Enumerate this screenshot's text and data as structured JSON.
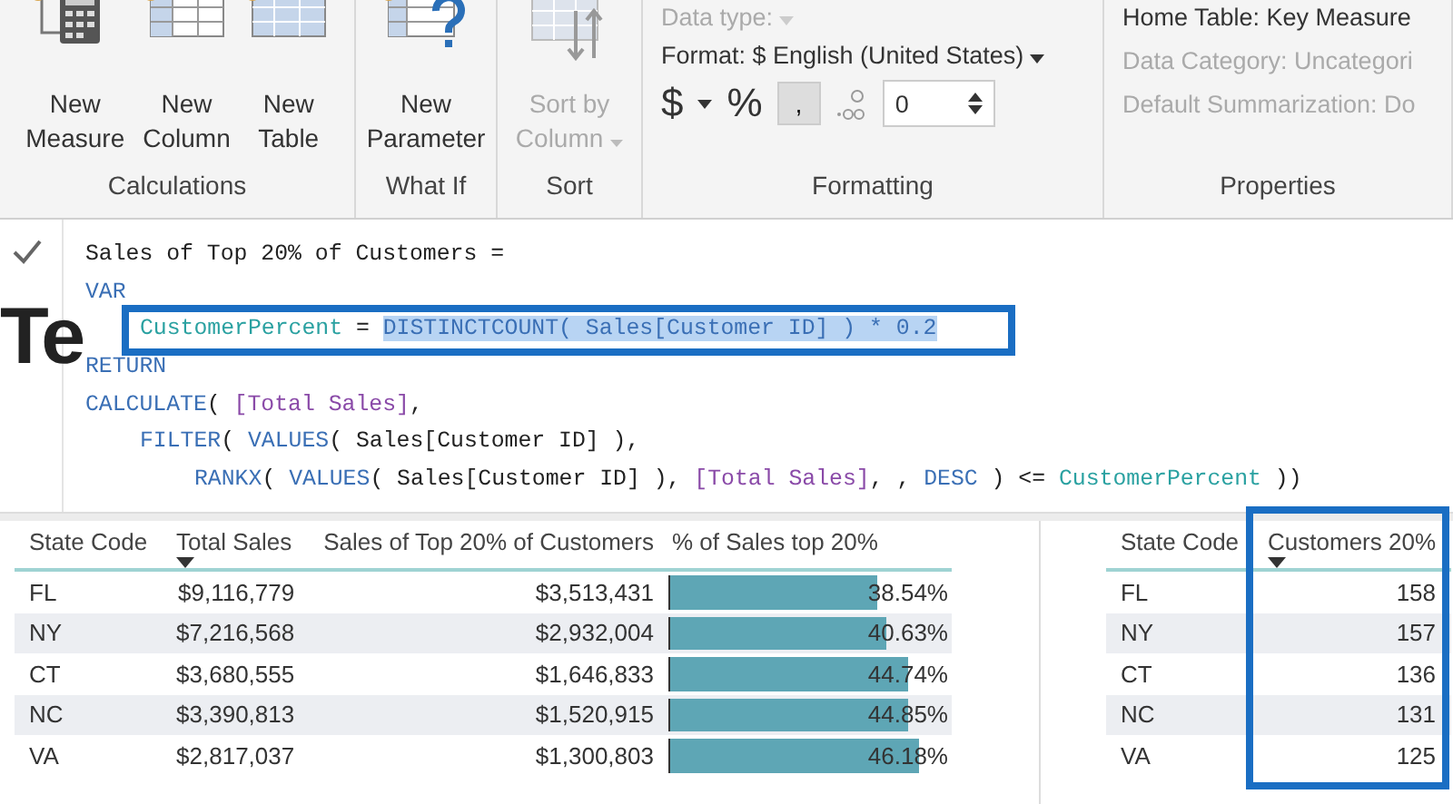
{
  "ribbon": {
    "groups": [
      {
        "kind": "buttons",
        "label": "Calculations",
        "buttons": [
          {
            "lines": [
              "New",
              "Measure"
            ],
            "disabled": false
          },
          {
            "lines": [
              "New",
              "Column"
            ],
            "disabled": false
          },
          {
            "lines": [
              "New",
              "Table"
            ],
            "disabled": false
          }
        ]
      },
      {
        "kind": "buttons",
        "label": "What If",
        "buttons": [
          {
            "lines": [
              "New",
              "Parameter"
            ],
            "disabled": false
          }
        ]
      },
      {
        "kind": "buttons",
        "label": "Sort",
        "buttons": [
          {
            "lines": [
              "Sort by",
              "Column"
            ],
            "disabled": true,
            "dropdown": true
          }
        ]
      },
      {
        "kind": "formatting",
        "label": "Formatting",
        "data_type": {
          "label": "Data type:",
          "disabled": true
        },
        "format": {
          "label": "Format: $ English (United States)"
        },
        "currency": "$",
        "percent": "%",
        "comma": {
          "label": ",",
          "selected": true
        },
        "decimals": {
          "value": "0"
        }
      },
      {
        "kind": "properties",
        "label": "Properties",
        "items": [
          {
            "text": "Home Table: Key Measure",
            "disabled": false
          },
          {
            "text": "Data Category: Uncategori",
            "disabled": true
          },
          {
            "text": "Default Summarization: Do",
            "disabled": true
          }
        ]
      }
    ]
  },
  "page_title": "Te",
  "formula": {
    "lines": [
      {
        "tokens": [
          {
            "kind": "plain",
            "text": "Sales of Top 20% of Customers ="
          }
        ]
      },
      {
        "tokens": [
          {
            "kind": "keyword",
            "text": "VAR"
          }
        ],
        "children": [
          {
            "tokens": [
              {
                "kind": "variable",
                "text": "CustomerPercent"
              },
              {
                "kind": "plain",
                "text": " = "
              },
              {
                "kind": "selected",
                "text": "DISTINCTCOUNT( Sales[Customer ID] ) * 0.2"
              }
            ]
          }
        ]
      },
      {
        "tokens": [
          {
            "kind": "keyword",
            "text": "RETURN"
          }
        ]
      },
      {
        "tokens": [
          {
            "kind": "keyword",
            "text": "CALCULATE"
          },
          {
            "kind": "plain",
            "text": "( "
          },
          {
            "kind": "measure",
            "text": "[Total Sales]"
          },
          {
            "kind": "plain",
            "text": ","
          }
        ],
        "children": [
          {
            "tokens": [
              {
                "kind": "keyword",
                "text": "FILTER"
              },
              {
                "kind": "plain",
                "text": "( "
              },
              {
                "kind": "keyword",
                "text": "VALUES"
              },
              {
                "kind": "plain",
                "text": "( Sales[Customer ID] ),"
              }
            ],
            "children": [
              {
                "tokens": [
                  {
                    "kind": "keyword",
                    "text": "RANKX"
                  },
                  {
                    "kind": "plain",
                    "text": "( "
                  },
                  {
                    "kind": "keyword",
                    "text": "VALUES"
                  },
                  {
                    "kind": "plain",
                    "text": "( Sales[Customer ID] ), "
                  },
                  {
                    "kind": "measure",
                    "text": "[Total Sales]"
                  },
                  {
                    "kind": "plain",
                    "text": ", , "
                  },
                  {
                    "kind": "keyword",
                    "text": "DESC"
                  },
                  {
                    "kind": "plain",
                    "text": " ) <= "
                  },
                  {
                    "kind": "variable",
                    "text": "CustomerPercent"
                  },
                  {
                    "kind": "plain",
                    "text": " ))"
                  }
                ]
              }
            ]
          }
        ]
      }
    ]
  },
  "tables": [
    {
      "columns": [
        {
          "title": "State Code",
          "kind": "text",
          "sorted": false
        },
        {
          "title": "Total Sales",
          "kind": "number",
          "sorted": true
        },
        {
          "title": "Sales of Top 20% of Customers",
          "kind": "number",
          "sorted": false
        },
        {
          "title": "% of Sales top 20%",
          "kind": "bar",
          "sorted": false
        }
      ],
      "rows": [
        {
          "cells": [
            {
              "text": "FL"
            },
            {
              "text": "$9,116,779"
            },
            {
              "text": "$3,513,431"
            },
            {
              "text": "38.54%",
              "level": 0.73
            }
          ]
        },
        {
          "cells": [
            {
              "text": "NY"
            },
            {
              "text": "$7,216,568"
            },
            {
              "text": "$2,932,004"
            },
            {
              "text": "40.63%",
              "level": 0.76
            }
          ]
        },
        {
          "cells": [
            {
              "text": "CT"
            },
            {
              "text": "$3,680,555"
            },
            {
              "text": "$1,646,833"
            },
            {
              "text": "44.74%",
              "level": 0.84
            }
          ]
        },
        {
          "cells": [
            {
              "text": "NC"
            },
            {
              "text": "$3,390,813"
            },
            {
              "text": "$1,520,915"
            },
            {
              "text": "44.85%",
              "level": 0.84
            }
          ]
        },
        {
          "cells": [
            {
              "text": "VA"
            },
            {
              "text": "$2,817,037"
            },
            {
              "text": "$1,300,803"
            },
            {
              "text": "46.18%",
              "level": 0.88
            }
          ]
        }
      ]
    },
    {
      "columns": [
        {
          "title": "State Code",
          "kind": "text",
          "sorted": false
        },
        {
          "title": "Customers 20%",
          "kind": "number",
          "sorted": true
        }
      ],
      "rows": [
        {
          "cells": [
            {
              "text": "FL"
            },
            {
              "text": "158"
            }
          ]
        },
        {
          "cells": [
            {
              "text": "NY"
            },
            {
              "text": "157"
            }
          ]
        },
        {
          "cells": [
            {
              "text": "CT"
            },
            {
              "text": "136"
            }
          ]
        },
        {
          "cells": [
            {
              "text": "NC"
            },
            {
              "text": "131"
            }
          ]
        },
        {
          "cells": [
            {
              "text": "VA"
            },
            {
              "text": "125"
            }
          ]
        }
      ]
    }
  ]
}
